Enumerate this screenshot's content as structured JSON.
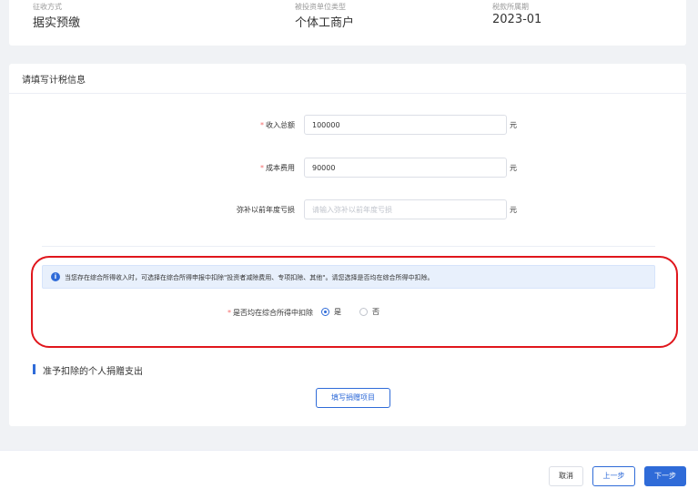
{
  "summary": [
    {
      "label": "征收方式",
      "value": "据实预缴"
    },
    {
      "label": "被投资单位类型",
      "value": "个体工商户"
    },
    {
      "label": "税款所属期",
      "value": "2023-01"
    }
  ],
  "form_card": {
    "title": "请填写计税信息",
    "required_mark": "*",
    "fields": [
      {
        "label": "收入总额",
        "value": "100000",
        "placeholder": "",
        "unit": "元",
        "required": true
      },
      {
        "label": "成本费用",
        "value": "90000",
        "placeholder": "",
        "unit": "元",
        "required": true
      },
      {
        "label": "弥补以前年度亏损",
        "value": "",
        "placeholder": "请输入弥补以前年度亏损",
        "unit": "元",
        "required": false
      }
    ],
    "notice": {
      "icon": "info-icon",
      "text": "当您存在综合所得收入时，可选择在综合所得申报中扣除\"投资者减除费用、专项扣除、其他\"。请您选择是否均在综合所得中扣除。"
    },
    "deduct_question": {
      "label": "是否均在综合所得中扣除",
      "options": [
        {
          "label": "是",
          "checked": true
        },
        {
          "label": "否",
          "checked": false
        }
      ]
    },
    "donation_section": {
      "title": "准予扣除的个人捐赠支出",
      "button_label": "填写捐赠项目"
    }
  },
  "footer": {
    "cancel_label": "取消",
    "prev_label": "上一步",
    "next_label": "下一步"
  },
  "colors": {
    "primary": "#2f6bd8",
    "required": "#f56c6c",
    "highlight": "#e0161c"
  }
}
